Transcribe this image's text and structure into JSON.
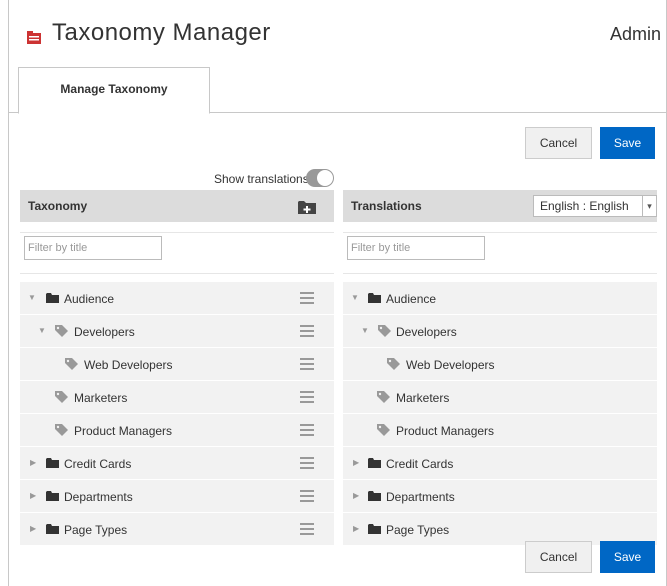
{
  "app": {
    "title": "Taxonomy Manager",
    "user": "Admin"
  },
  "tabs": [
    {
      "label": "Manage Taxonomy",
      "active": true
    }
  ],
  "actions": {
    "cancel": "Cancel",
    "save": "Save"
  },
  "toggle": {
    "label": "Show translations",
    "on": true
  },
  "left_panel": {
    "title": "Taxonomy",
    "filter_placeholder": "Filter by title"
  },
  "right_panel": {
    "title": "Translations",
    "language": "English : English",
    "filter_placeholder": "Filter by title"
  },
  "tree": [
    {
      "label": "Audience",
      "type": "folder",
      "expanded": true,
      "depth": 0
    },
    {
      "label": "Developers",
      "type": "tag",
      "expanded": true,
      "depth": 1
    },
    {
      "label": "Web Developers",
      "type": "tag",
      "depth": 2
    },
    {
      "label": "Marketers",
      "type": "tag",
      "depth": 1
    },
    {
      "label": "Product Managers",
      "type": "tag",
      "depth": 1
    },
    {
      "label": "Credit Cards",
      "type": "folder",
      "expanded": false,
      "depth": 0
    },
    {
      "label": "Departments",
      "type": "folder",
      "expanded": false,
      "depth": 0
    },
    {
      "label": "Page Types",
      "type": "folder",
      "expanded": false,
      "depth": 0
    }
  ],
  "colors": {
    "primary": "#0067c5",
    "header_bg": "#dcdcdc",
    "row_bg": "#f2f2f2",
    "app_icon": "#cc3333"
  }
}
